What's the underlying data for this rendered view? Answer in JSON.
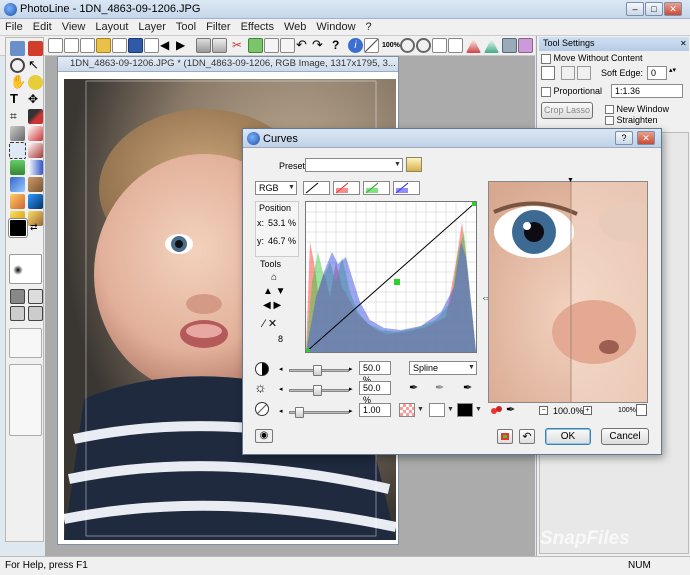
{
  "app": {
    "title": "PhotoLine - 1DN_4863-09-1206.JPG",
    "window_controls": [
      "–",
      "□",
      "✕"
    ]
  },
  "menu": [
    "File",
    "Edit",
    "View",
    "Layout",
    "Layer",
    "Tool",
    "Filter",
    "Effects",
    "Web",
    "Window",
    "?"
  ],
  "toolbar": {
    "zoom_label": "100%"
  },
  "document": {
    "title": "1DN_4863-09-1206.JPG * (1DN_4863-09-1206, RGB Image, 1317x1795, 3..."
  },
  "tool_settings": {
    "title": "Tool Settings",
    "move_without_content": "Move Without Content",
    "soft_edge_label": "Soft Edge:",
    "soft_edge_value": "0",
    "proportional": "Proportional",
    "ratio_value": "1:1.36",
    "crop_lasso": "Crop Lasso",
    "new_window": "New Window",
    "straighten": "Straighten"
  },
  "status": {
    "help": "For Help, press F1",
    "num": "NUM"
  },
  "curves": {
    "title": "Curves",
    "preset_label": "Preset:",
    "channel": "RGB",
    "position_label": "Position",
    "x_label": "x:",
    "x_value": "53.1 %",
    "y_label": "y:",
    "y_value": "46.7 %",
    "tools_label": "Tools",
    "tool_count": "8",
    "slider1_value": "50.0 %",
    "slider2_value": "50.0 %",
    "slider3_value": "1.00",
    "interpolation": "Spline",
    "zoom_left": "100.0%",
    "zoom_right": "100%",
    "ok": "OK",
    "cancel": "Cancel",
    "help_btn": "?"
  },
  "watermark": "SnapFiles"
}
